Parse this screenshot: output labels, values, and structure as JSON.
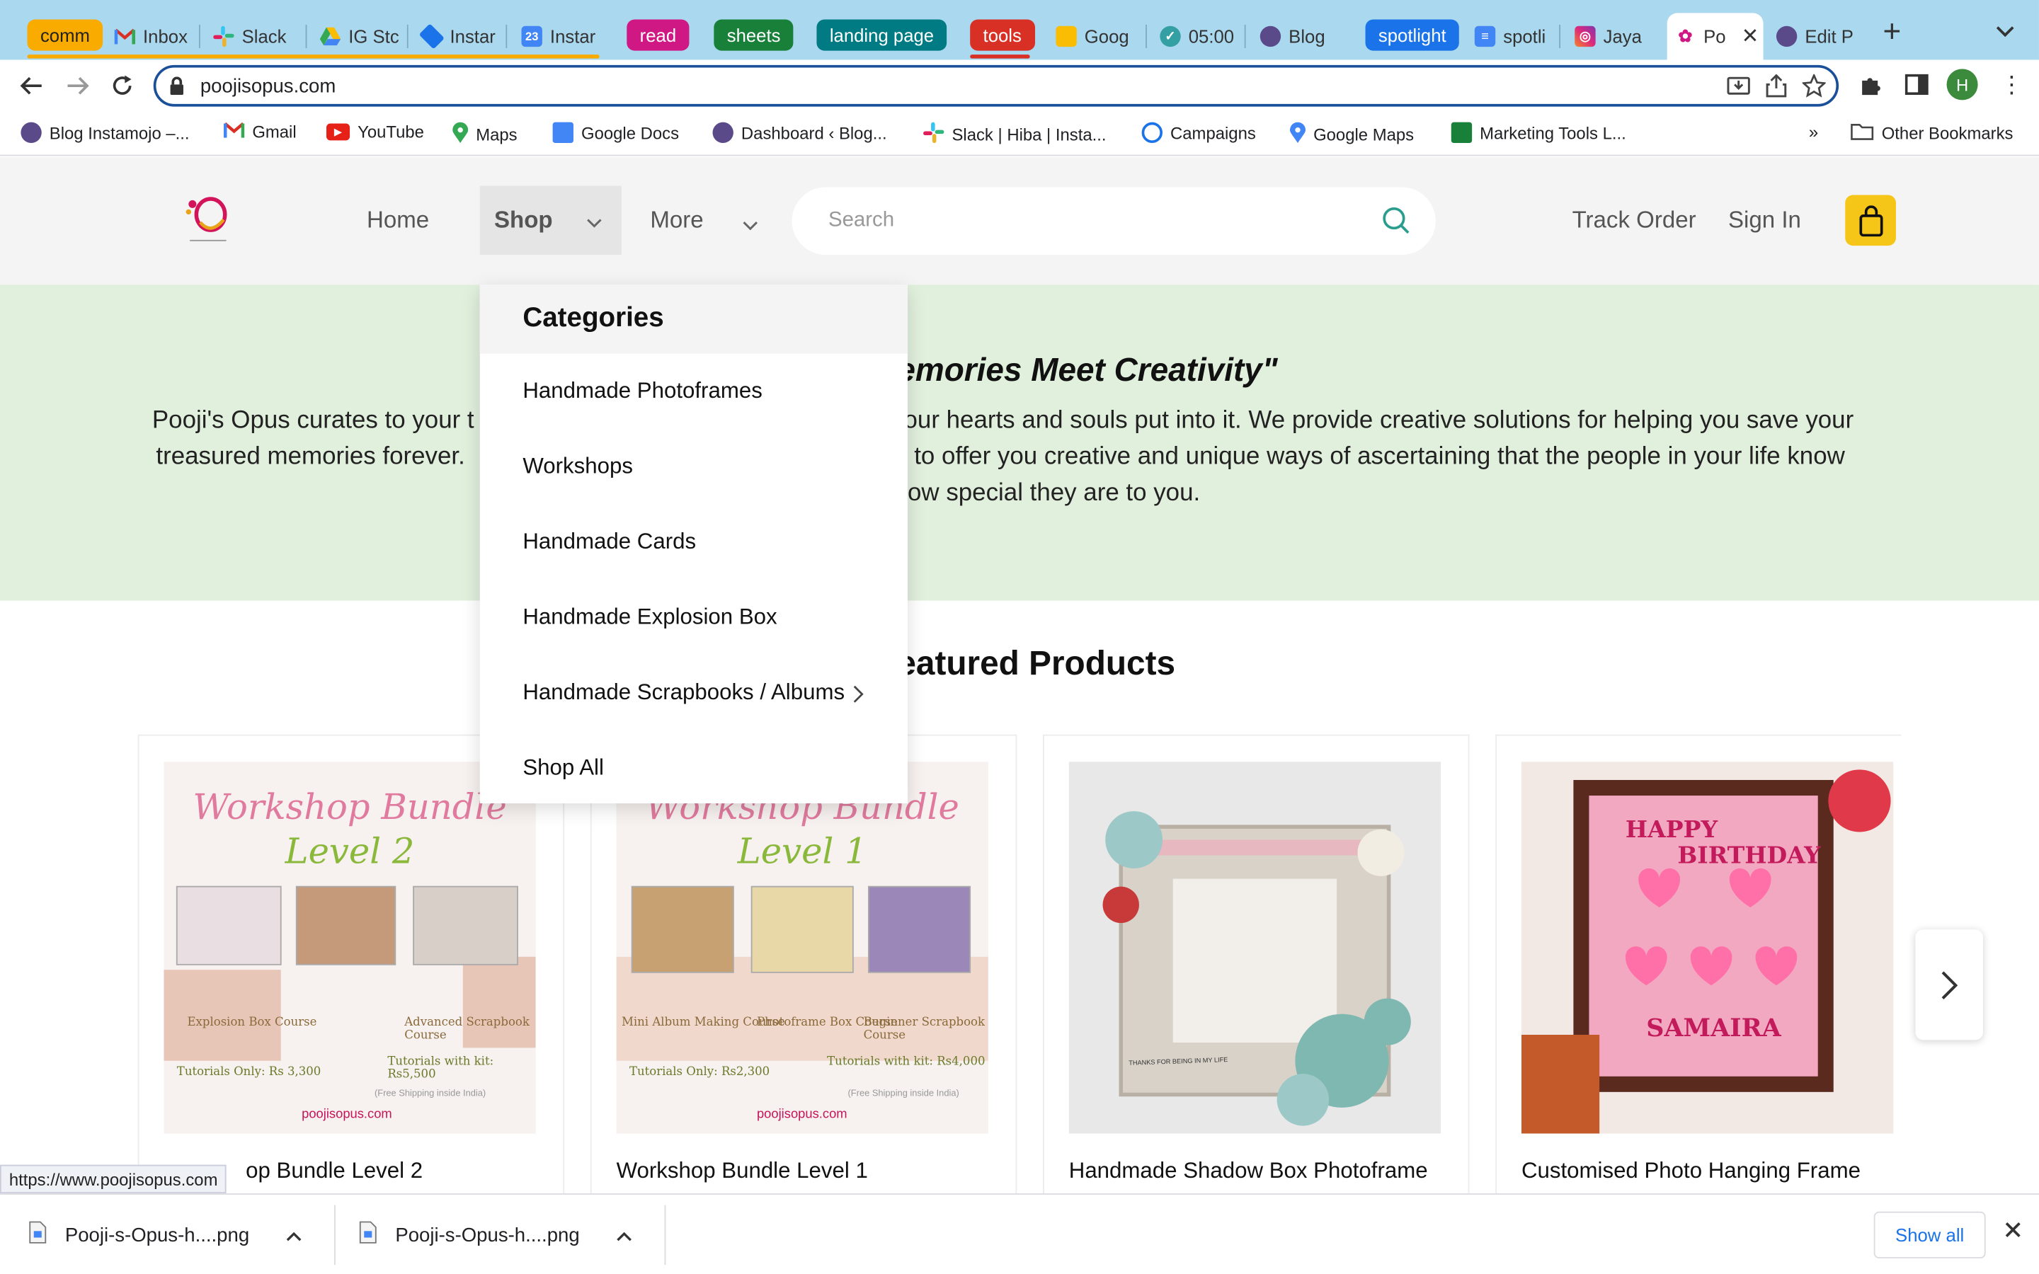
{
  "browser": {
    "tabs": [
      {
        "label": "comm",
        "kind": "group",
        "color": "#f9ab00"
      },
      {
        "label": "Inbox"
      },
      {
        "label": "Slack"
      },
      {
        "label": "IG Stc"
      },
      {
        "label": "Instar"
      },
      {
        "label": "Instar"
      },
      {
        "label": "read",
        "kind": "group",
        "color": "#d01884"
      },
      {
        "label": "sheets",
        "kind": "group",
        "color": "#188038"
      },
      {
        "label": "landing page",
        "kind": "group",
        "color": "#007b83"
      },
      {
        "label": "tools",
        "kind": "group",
        "color": "#d93025"
      },
      {
        "label": "Goog"
      },
      {
        "label": "05:00"
      },
      {
        "label": "Blog"
      },
      {
        "label": "spotlight",
        "kind": "group",
        "color": "#1a73e8"
      },
      {
        "label": "spotli"
      },
      {
        "label": "Jaya"
      },
      {
        "label": "Po",
        "active": true
      },
      {
        "label": "Edit P"
      }
    ],
    "new_tab": "+",
    "url": "poojisopus.com",
    "profile_initial": "H",
    "bookmarks": [
      "Blog Instamojo –...",
      "Gmail",
      "YouTube",
      "Maps",
      "Google Docs",
      "Dashboard ‹ Blog...",
      "Slack | Hiba | Insta...",
      "Campaigns",
      "Google Maps",
      "Marketing Tools L...",
      "»",
      "Other Bookmarks"
    ]
  },
  "site": {
    "nav": {
      "home": "Home",
      "shop": "Shop",
      "more": "More",
      "search_placeholder": "Search",
      "track_order": "Track Order",
      "sign_in": "Sign In"
    },
    "hero": {
      "title_visible": "emories Meet Creativity\"",
      "line1_left": "Pooji's Opus curates to your t",
      "line1_right": "our hearts and souls put into it. We provide creative solutions for helping you save your",
      "line2_left": "treasured memories forever.",
      "line2_right": "to offer you creative and unique ways of ascertaining that the people in your life know",
      "line3_right": "ow special they are to you."
    },
    "featured_title_visible": "eatured Products",
    "products": [
      {
        "name": "Workshop Bundle Level 2",
        "visible_name": "op Bundle Level 2",
        "img_title": "Workshop Bundle",
        "img_level": "Level 2",
        "courses": [
          "Explosion Box Course",
          "Advanced Scrapbook Course"
        ],
        "price_left": "Tutorials Only: Rs 3,300",
        "price_right": "Tutorials with kit: Rs5,500",
        "ship": "(Free Shipping inside India)",
        "site": "poojisopus.com"
      },
      {
        "name": "Workshop Bundle Level 1",
        "visible_name": "Workshop Bundle Level 1",
        "img_title": "Workshop Bundle",
        "img_level": "Level 1",
        "courses": [
          "Mini Album Making Course",
          "Photoframe Box Course",
          "Beginner Scrapbook Course"
        ],
        "price_left": "Tutorials Only: Rs2,300",
        "price_right": "Tutorials with kit: Rs4,000",
        "ship": "(Free Shipping inside India)",
        "site": "poojisopus.com"
      },
      {
        "name": "Handmade Shadow Box Photoframe",
        "visible_name": "Handmade Shadow Box Photoframe",
        "img_caption": "THANKS FOR BEING IN MY LIFE"
      },
      {
        "name": "Customised Photo Hanging Frame",
        "visible_name": "Customised Photo Hanging Frame",
        "img_line1": "HAPPY",
        "img_line2": "BIRTHDAY",
        "img_line3": "SAMAIRA"
      }
    ],
    "dropdown": {
      "heading": "Categories",
      "items": [
        "Handmade Photoframes",
        "Workshops",
        "Handmade Cards",
        "Handmade Explosion Box",
        "Handmade Scrapbooks / Albums",
        "Shop All"
      ]
    }
  },
  "status_url": "https://www.poojisopus.com",
  "downloads": {
    "items": [
      "Pooji-s-Opus-h....png",
      "Pooji-s-Opus-h....png"
    ],
    "show_all": "Show all"
  },
  "colors": {
    "accent_yellow": "#f5c518",
    "hero_bg": "#e1efdd",
    "tabstrip": "#a9d8ef"
  }
}
